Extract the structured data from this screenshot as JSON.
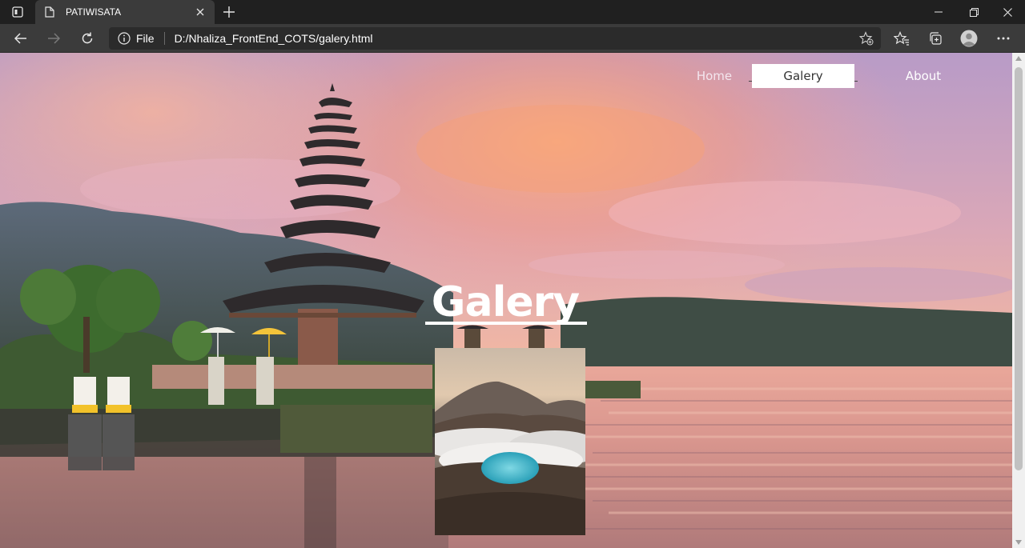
{
  "browser": {
    "tab": {
      "title": "PATIWISATA"
    },
    "address_bar": {
      "scheme_label": "File",
      "url": "D:/Nhaliza_FrontEnd_COTS/galery.html"
    },
    "icons": {
      "tab_actions": "tab-actions-icon",
      "favicon": "document-icon",
      "close_tab": "close-icon",
      "new_tab": "plus-icon",
      "minimize": "minimize-icon",
      "restore": "restore-icon",
      "close_window": "close-icon",
      "back": "arrow-left-icon",
      "forward": "arrow-right-icon",
      "refresh": "refresh-icon",
      "info": "info-icon",
      "add_favorite": "star-plus-icon",
      "favorites": "favorites-icon",
      "collections": "collections-icon",
      "profile": "profile-icon",
      "more": "more-icon"
    }
  },
  "site": {
    "nav": {
      "home": "Home",
      "galery": "Galery",
      "about": "About"
    },
    "hero_title": "Galery",
    "colors": {
      "active_nav_bg": "#ffffff",
      "title_color": "#ffffff"
    }
  }
}
